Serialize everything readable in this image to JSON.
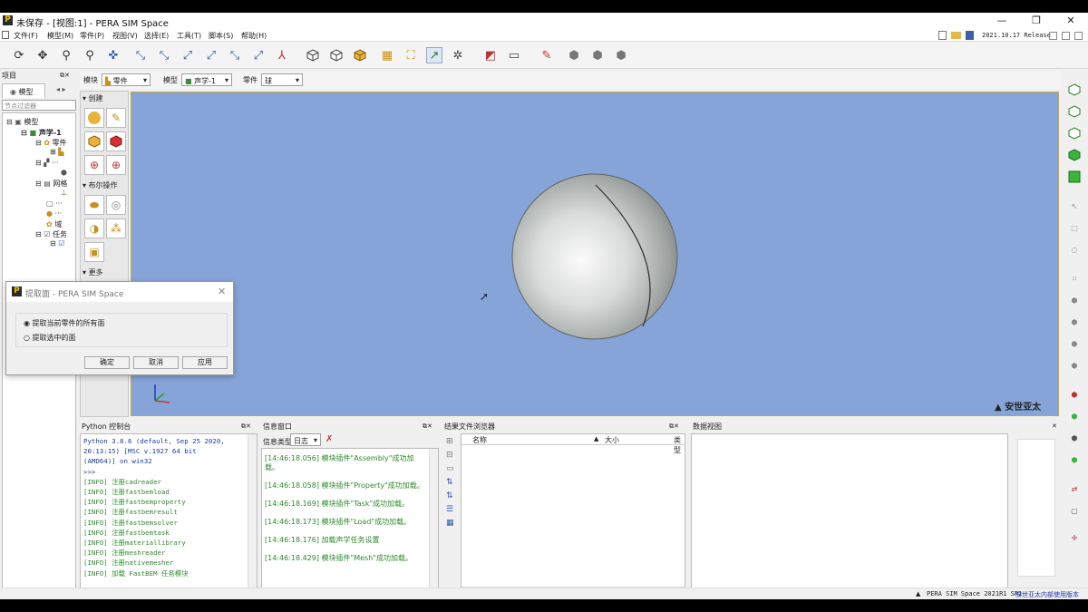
{
  "app": {
    "title": "未保存 - [视图:1] - PERA SIM Space",
    "version": "2021.10.17 Release"
  },
  "window_controls": {
    "minimize": "—",
    "maximize": "❐",
    "close": "✕"
  },
  "menu": [
    "文件(F)",
    "模型(M)",
    "零件(P)",
    "视图(V)",
    "选择(E)",
    "工具(T)",
    "脚本(S)",
    "帮助(H)"
  ],
  "project_panel": {
    "title": "项目",
    "tab": "模型",
    "filter_placeholder": "节点过滤器"
  },
  "tree": {
    "root": "模型",
    "acoustic": "声学-1",
    "parts": "零件",
    "dots": "···",
    "mesh": "网格",
    "domain": "域",
    "task": "任务"
  },
  "module_bar": {
    "module_label": "模块",
    "module_value": "零件",
    "model_label": "模型",
    "model_value": "声学-1",
    "part_label": "零件",
    "part_value": "球"
  },
  "palette": {
    "create": "创建",
    "boolean": "布尔操作",
    "more": "更多"
  },
  "dialog": {
    "title": "提取面 - PERA SIM Space",
    "option1": "提取当前零件的所有面",
    "option2": "提取选中的面",
    "ok": "确定",
    "cancel": "取消",
    "apply": "应用"
  },
  "brand": "安世亚太",
  "python_console": {
    "title": "Python 控制台",
    "lines": [
      "Python 3.8.6 (default, Sep 25 2020,",
      "20:13:15) [MSC v.1927 64 bit",
      "(AMD64)] on win32",
      ">>>",
      "[INFO] 注册cadreader",
      "[INFO] 注册fastbemload",
      "[INFO] 注册fastbemproperty",
      "[INFO] 注册fastbemresult",
      "[INFO] 注册fastbemsolver",
      "[INFO] 注册fastbemtask",
      "[INFO] 注册materiallibrary",
      "[INFO] 注册meshreader",
      "[INFO] 注册nativemesher",
      "[INFO] 加载 FastBEM 任务模块"
    ]
  },
  "info_window": {
    "title": "信息窗口",
    "type_label": "信息类型",
    "type_value": "日志",
    "logs": [
      "[14:46:18.056] 模块插件\"Assembly\"成功加载。",
      "[14:46:18.058] 模块插件\"Property\"成功加载。",
      "[14:46:18.169] 模块插件\"Task\"成功加载。",
      "[14:46:18.173] 模块插件\"Load\"成功加载。",
      "[14:46:18.176] 加载声学任务设置",
      "[14:46:18.429] 模块插件\"Mesh\"成功加载。"
    ]
  },
  "results_browser": {
    "title": "结果文件浏览器",
    "col_name": "名称",
    "col_size": "大小",
    "col_type": "类型"
  },
  "data_view": {
    "title": "数据视图"
  },
  "status": {
    "text": "PERA SIM Space 2021R1 SP1",
    "link": "安世亚太内部使用版本"
  },
  "colors": {
    "viewport": "#87a4d8",
    "sphere": "#d4d8d6"
  }
}
